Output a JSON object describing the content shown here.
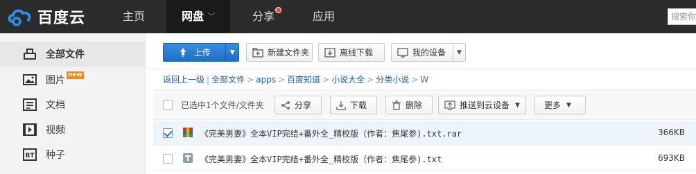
{
  "header": {
    "logo_text": "百度云",
    "nav": {
      "home": "主页",
      "pan": "网盘",
      "share": "分享",
      "app": "应用"
    },
    "search_placeholder": "搜索你"
  },
  "sidebar": {
    "items": [
      {
        "label": "全部文件",
        "icon": "folder-icon"
      },
      {
        "label": "图片",
        "icon": "image-icon",
        "badge": "new"
      },
      {
        "label": "文档",
        "icon": "document-icon"
      },
      {
        "label": "视频",
        "icon": "video-icon"
      },
      {
        "label": "种子",
        "icon": "bt-icon",
        "icon_text": "BT"
      }
    ]
  },
  "toolbar": {
    "upload": "上传",
    "new_folder": "新建文件夹",
    "offline_download": "离线下载",
    "my_devices": "我的设备"
  },
  "breadcrumb": {
    "back": "返回上一级",
    "items": [
      "全部文件",
      "apps",
      "百度知道",
      "小说大全",
      "分类小说"
    ],
    "current": "W"
  },
  "selection": {
    "text": "已选中1个文件/文件夹",
    "share": "分享",
    "download": "下载",
    "delete": "删除",
    "push": "推送到云设备",
    "more": "更多"
  },
  "files": [
    {
      "name": "《完美男妻》全本VIP完结+番外全_精校版（作者：焦尾参).txt.rar",
      "size": "366KB",
      "checked": true,
      "icon": "rar-archive-icon"
    },
    {
      "name": "《完美男妻》全本VIP完结+番外全_精校版（作者：焦尾参).txt",
      "size": "693KB",
      "checked": false,
      "icon": "txt-file-icon"
    }
  ],
  "colors": {
    "topbar": "#2b2b2b",
    "accent": "#2f7fd4",
    "link": "#1b5fa8",
    "badge": "#f08a1c"
  }
}
